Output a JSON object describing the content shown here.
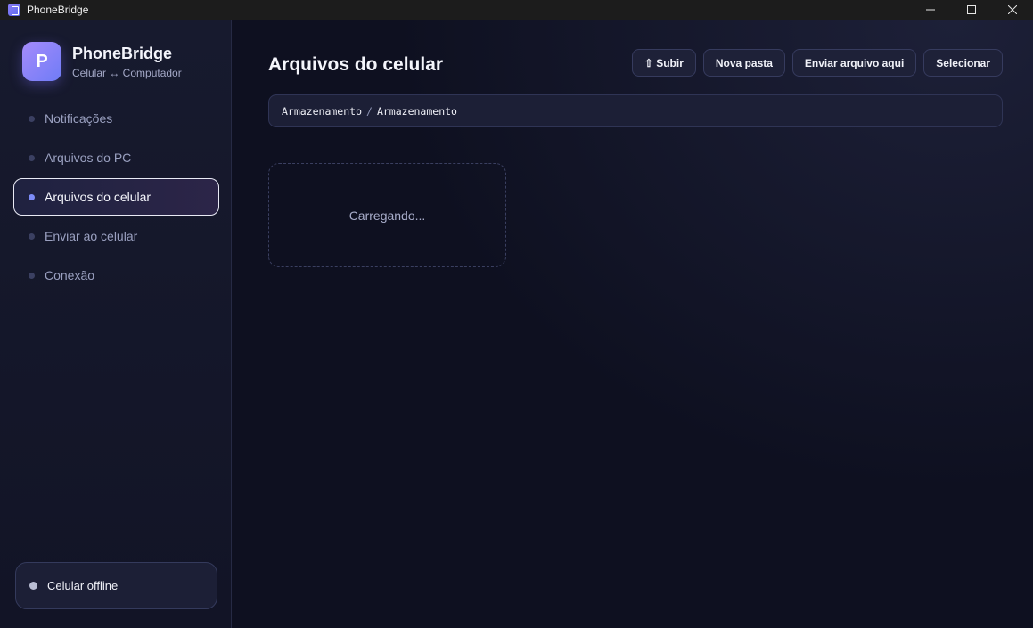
{
  "window": {
    "title": "PhoneBridge",
    "controls": [
      "minimize-icon",
      "maximize-icon",
      "close-icon"
    ]
  },
  "sidebar": {
    "brand": {
      "logo_letter": "P",
      "name": "PhoneBridge",
      "subtitle": "Celular ↔ Computador"
    },
    "items": [
      {
        "label": "Notificações",
        "active": false
      },
      {
        "label": "Arquivos do PC",
        "active": false
      },
      {
        "label": "Arquivos do celular",
        "active": true
      },
      {
        "label": "Enviar ao celular",
        "active": false
      },
      {
        "label": "Conexão",
        "active": false
      }
    ],
    "status": {
      "label": "Celular offline",
      "color": "#b9bdd3"
    }
  },
  "main": {
    "title": "Arquivos do celular",
    "toolbar": {
      "up_label": "⇧ Subir",
      "new_folder_label": "Nova pasta",
      "upload_label": "Enviar arquivo aqui",
      "select_label": "Selecionar"
    },
    "breadcrumb": [
      "Armazenamento",
      "Armazenamento"
    ],
    "breadcrumb_separator": "/",
    "loading_text": "Carregando..."
  },
  "colors": {
    "accent": "#7d8cf8",
    "background": "#0e1020",
    "sidebar": "#171a2e"
  }
}
